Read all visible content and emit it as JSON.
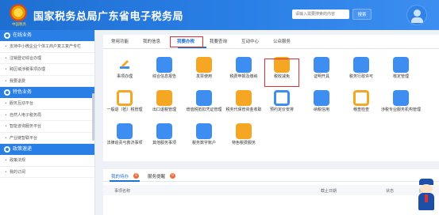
{
  "header": {
    "title": "国家税务总局广东省电子税务局",
    "emblem_text": "中国税务",
    "search_placeholder": "请输入需要搜索的内容",
    "search_button": "搜索"
  },
  "sidebar": {
    "sections": [
      {
        "title": "在线业务",
        "items": [
          "支持中小微企业个体工商户复工复产专栏",
          "注销登记综合办理",
          "跨区域涉税事项办理",
          "我要退费"
        ]
      },
      {
        "title": "特色业务",
        "items": [
          "服务互动平台",
          "自然人电子税务局",
          "智能咨询服务平台",
          "产业链智联平台"
        ]
      },
      {
        "title": "政策速递",
        "items": [
          "政策法规",
          "我的订阅"
        ]
      }
    ]
  },
  "main": {
    "tabs": [
      "常用功能",
      "我的信息",
      "我要办税",
      "我要查询",
      "互动中心",
      "公众服务"
    ],
    "active_tab": "我要办税",
    "tiles": [
      [
        "事项办理",
        "综合信息报告",
        "发票使用",
        "税费申报及缴纳",
        "税收减免",
        "证明开具",
        "税务行政许可",
        "核定管理"
      ],
      [
        "一般退（抵）税管理",
        "出口退税管理",
        "增值税抵扣凭证管理",
        "税务代保管资金收取",
        "预约定价安排",
        "纳税信用",
        "稽查检查",
        "涉税专业服务机构管理"
      ],
      [
        "法律追责与救济事项",
        "其他服务事项",
        "税务数字账户",
        "特色税费服务"
      ]
    ]
  },
  "todo": {
    "tabs": [
      "我的待办",
      "服务提醒"
    ],
    "badges": [
      "0",
      "0"
    ],
    "columns": [
      "事项名称",
      "截止日期",
      "状态",
      "操作"
    ]
  },
  "colors": {
    "brand_blue": "#1f6fd1",
    "accent_orange": "#f5a623",
    "highlight_red": "#e03030"
  }
}
